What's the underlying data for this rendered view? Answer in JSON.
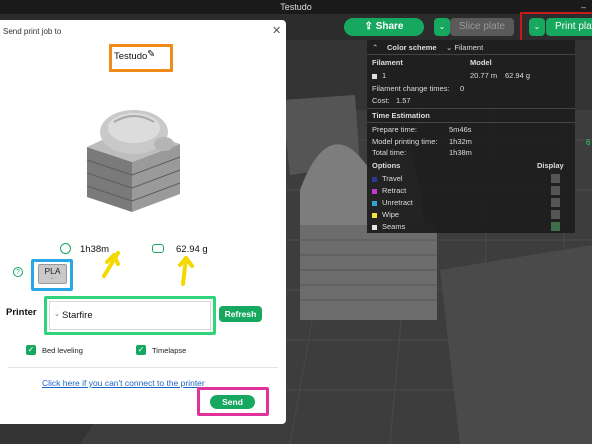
{
  "window": {
    "title": "Testudo",
    "min_glyph": "–"
  },
  "toolbar": {
    "share_label": "Share",
    "share_icon": "share-icon",
    "dropdown_glyph": "⌄",
    "slice_label": "Slice plate",
    "print_label": "Print plate"
  },
  "viewport": {
    "side_number": "6"
  },
  "color_scheme": {
    "collapse_glyph": "⌃",
    "title": "Color scheme",
    "scheme_chevron": "⌄",
    "scheme_value": "Filament",
    "col_filament": "Filament",
    "col_model": "Model",
    "filament_id": "1",
    "filament_length": "20.77 m",
    "filament_weight": "62.94 g",
    "change_times_label": "Filament change times:",
    "change_times_value": "0",
    "cost_label": "Cost:",
    "cost_value": "1.57",
    "time_header": "Time Estimation",
    "prepare_label": "Prepare time:",
    "prepare_value": "5m46s",
    "model_time_label": "Model printing time:",
    "model_time_value": "1h32m",
    "total_label": "Total time:",
    "total_value": "1h38m",
    "options_header": "Options",
    "display_header": "Display",
    "options": [
      {
        "label": "Travel",
        "color": "#2a3a9a",
        "checked": false
      },
      {
        "label": "Retract",
        "color": "#c23ac9",
        "checked": false
      },
      {
        "label": "Unretract",
        "color": "#2fa6d6",
        "checked": false
      },
      {
        "label": "Wipe",
        "color": "#f2e23a",
        "checked": false
      },
      {
        "label": "Seams",
        "color": "#e5e5e5",
        "checked": true
      }
    ]
  },
  "dialog": {
    "title": "Send print job to",
    "close_glyph": "✕",
    "model_name": "Testudo",
    "edit_glyph": "✎",
    "print_time": "1h38m",
    "weight": "62.94 g",
    "help_glyph": "?",
    "filament_type": "PLA",
    "filament_sub": "⌄",
    "printer_label": "Printer",
    "printer_chevron": "⌄",
    "printer_value": "Starfire",
    "refresh_label": "Refresh",
    "check_glyph": "✓",
    "bed_leveling_label": "Bed leveling",
    "bed_leveling_checked": true,
    "timelapse_label": "Timelapse",
    "timelapse_checked": true,
    "connect_link": "Click here if you can't connect to the printer",
    "send_label": "Send"
  },
  "colors": {
    "accent": "#16a85f",
    "highlight_orange": "#f08a19",
    "highlight_blue": "#2aa7e6",
    "highlight_green": "#2ed37a",
    "highlight_pink": "#e0329d",
    "highlight_red": "#c41a1a",
    "arrow_yellow": "#f5d800"
  }
}
